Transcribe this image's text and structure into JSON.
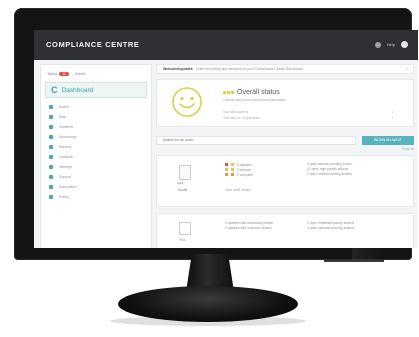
{
  "app": {
    "brand": "COMPLIANCE CENTRE"
  },
  "topbar": {
    "user_label": "Help"
  },
  "sidebar": {
    "tabs": [
      {
        "label": "Tasks",
        "badge": "12"
      },
      {
        "label": "Alerts"
      }
    ],
    "dashboard": {
      "letter": "C",
      "label": "Dashboard"
    },
    "items": [
      {
        "label": "Audits"
      },
      {
        "label": "Risk"
      },
      {
        "label": "Incidents"
      },
      {
        "label": "Workshops"
      },
      {
        "label": "Reports"
      },
      {
        "label": "Contacts"
      },
      {
        "label": "Settings"
      },
      {
        "label": "Support"
      },
      {
        "label": "Subscribed"
      },
      {
        "label": "Policy"
      }
    ]
  },
  "notice": {
    "strong": "Welcome/updates",
    "text": "Grab everything and welcome to your Compliance Centre Dashboard",
    "close": "×"
  },
  "status": {
    "title": "Overall status",
    "subtitle": "Overall lines your current and calculated",
    "lines": [
      {
        "left": "Your last score is",
        "right": "•"
      },
      {
        "left": "Your last no. of questions",
        "right": "•"
      }
    ],
    "colors": {
      "good": "#e9c94a",
      "mid": "#e49a3a",
      "bad": "#d9534f"
    }
  },
  "search": {
    "placeholder": "Search for an audit...",
    "button": "BEGIN AN AUDIT",
    "sort": "Show all"
  },
  "audit": {
    "score": "●●●",
    "type": "Audit",
    "rows": [
      {
        "label": "2 updates",
        "color": "#d9534f"
      },
      {
        "label": "3 reviews",
        "color": "#e9c94a"
      },
      {
        "label": "2 complete",
        "color": "#e49a3a"
      }
    ],
    "link": "View audit details",
    "actions": [
      "3 open actions pending review",
      "12 open high priority actions",
      "2 open medium priority actions"
    ]
  },
  "card3": {
    "label": "Risk",
    "left": [
      "3 updates with scheduled people",
      "2 updates with unknown actions"
    ],
    "right": [
      "3 open moderate priority actions",
      "4 open uploaded priority actions"
    ]
  },
  "colors": {
    "accent": "#58b4bc",
    "topbar": "#2e3033",
    "badge": "#e64a4a"
  }
}
